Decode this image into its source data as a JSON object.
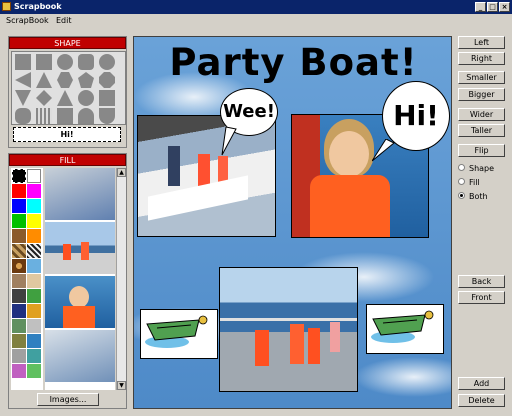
{
  "window": {
    "title": "Scrapbook"
  },
  "menu": [
    "ScrapBook",
    "Edit"
  ],
  "shape_panel": {
    "header": "SHAPE",
    "preview_text": "Hi!"
  },
  "fill_panel": {
    "header": "FILL",
    "images_button": "Images..."
  },
  "canvas": {
    "title": "Party Boat!",
    "bubble_left": "Wee!",
    "bubble_right": "Hi!"
  },
  "side_buttons": {
    "left": "Left",
    "right": "Right",
    "smaller": "Smaller",
    "bigger": "Bigger",
    "wider": "Wider",
    "taller": "Taller",
    "flip": "Flip",
    "back": "Back",
    "front": "Front",
    "add": "Add",
    "delete": "Delete"
  },
  "apply_to": {
    "options": [
      "Shape",
      "Fill",
      "Both"
    ],
    "selected": "Both"
  },
  "colors": {
    "titlebar": "#0a246a",
    "panel_header": "#c00000",
    "canvas_bg": "#5d9ad6"
  }
}
